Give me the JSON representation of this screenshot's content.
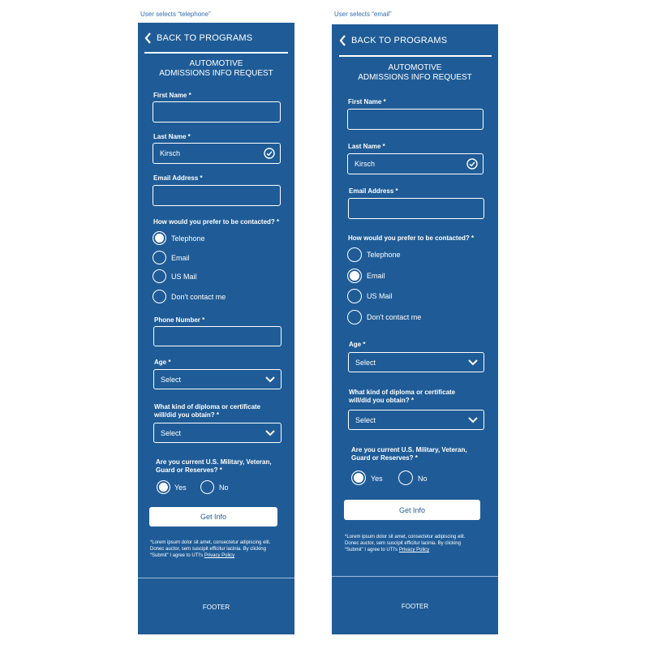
{
  "captions": {
    "left": "User selects “telephone”",
    "right": "User selects “email”"
  },
  "form": {
    "back_label": "BACK TO PROGRAMS",
    "title_line1": "AUTOMOTIVE",
    "title_line2": "ADMISSIONS INFO REQUEST",
    "first_name_label": "First Name *",
    "last_name_label": "Last Name *",
    "last_name_value": "Kirsch",
    "email_label": "Email Address *",
    "contact_question": "How would you prefer to be contacted? *",
    "contact_options": [
      "Telephone",
      "Email",
      "US Mail",
      "Don't contact me"
    ],
    "phone_label": "Phone Number *",
    "age_label": "Age *",
    "select_placeholder": "Select",
    "diploma_line1": "What kind of diploma or certificate",
    "diploma_line2": "will/did you obtain? *",
    "military_line1": "Are you current U.S. Military, Veteran,",
    "military_line2": "Guard or Reserves? *",
    "yes_label": "Yes",
    "no_label": "No",
    "submit_label": "Get Info",
    "legal_line1": "*Lorem ipsum dolor sit amet, consectetur adipiscing elit.",
    "legal_line2": "Donec auctor, sem suscipit efficitur lacinia. By clicking",
    "legal_line3": "“Submit” I agree to UTI's",
    "privacy_link": "Privacy Policy",
    "footer_label": "FOOTER"
  },
  "left_panel": {
    "selected_contact": "Telephone",
    "military_selected": "Yes"
  },
  "right_panel": {
    "selected_contact": "Email",
    "military_selected": "Yes"
  },
  "colors": {
    "panel_bg": "#1f5c97",
    "caption": "#2f6db3",
    "foreground": "#ffffff"
  },
  "icons": [
    "chevron-left-icon",
    "checkmark-circle-icon",
    "chevron-down-icon"
  ]
}
